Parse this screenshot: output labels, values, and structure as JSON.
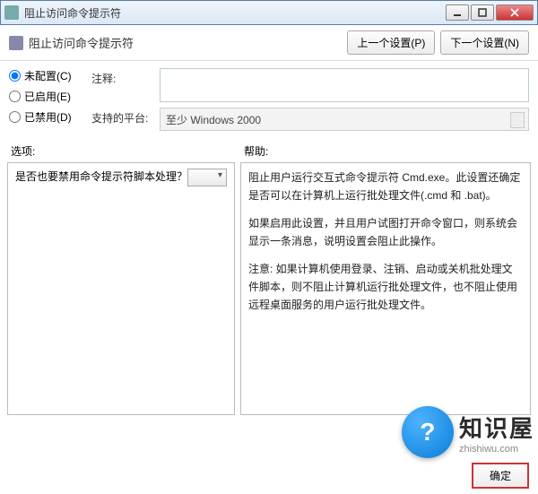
{
  "titlebar": {
    "title": "阻止访问命令提示符"
  },
  "header": {
    "title": "阻止访问命令提示符",
    "prev_btn": "上一个设置(P)",
    "next_btn": "下一个设置(N)"
  },
  "radios": {
    "not_configured": "未配置(C)",
    "enabled": "已启用(E)",
    "disabled": "已禁用(D)"
  },
  "fields": {
    "comment_label": "注释:",
    "comment_value": "",
    "platform_label": "支持的平台:",
    "platform_value": "至少 Windows 2000"
  },
  "mid": {
    "options_label": "选项:",
    "help_label": "帮助:"
  },
  "options": {
    "question": "是否也要禁用命令提示符脚本处理？"
  },
  "help": {
    "p1": "阻止用户运行交互式命令提示符 Cmd.exe。此设置还确定是否可以在计算机上运行批处理文件(.cmd 和 .bat)。",
    "p2": "如果启用此设置，并且用户试图打开命令窗口，则系统会显示一条消息，说明设置会阻止此操作。",
    "p3": "注意: 如果计算机使用登录、注销、启动或关机批处理文件脚本，则不阻止计算机运行批处理文件，也不阻止使用远程桌面服务的用户运行批处理文件。"
  },
  "buttons": {
    "ok": "确定"
  },
  "watermark": {
    "glyph": "?",
    "main": "知识屋",
    "sub": "zhishiwu.com"
  }
}
